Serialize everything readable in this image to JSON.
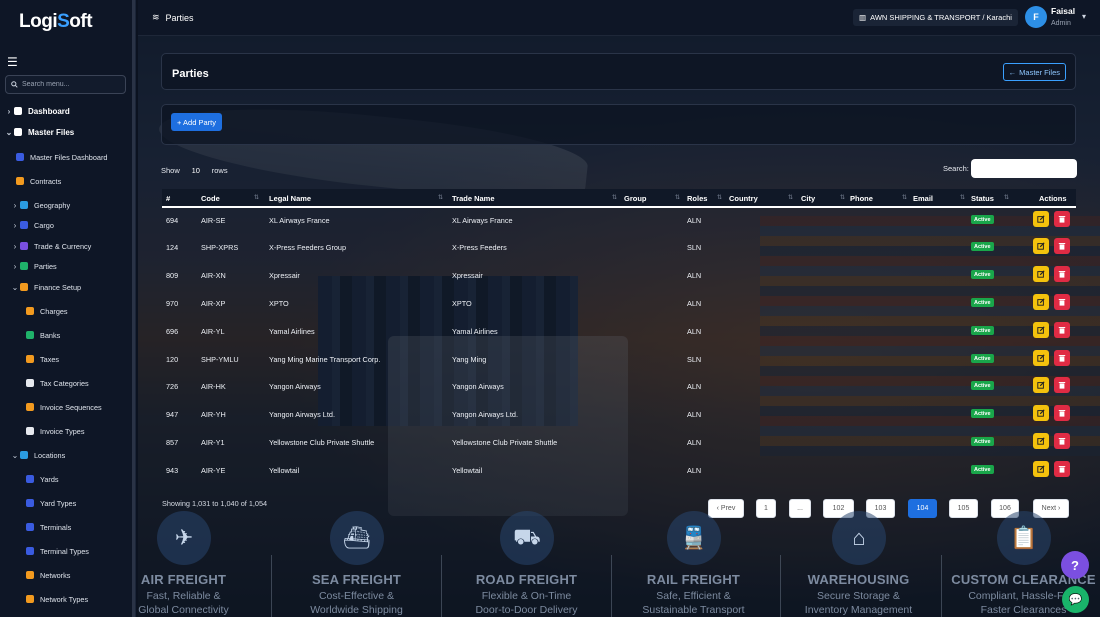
{
  "app": {
    "logo_a": "Logi",
    "logo_o": "S",
    "logo_b": "oft"
  },
  "sidebar": {
    "search_placeholder": "Search menu...",
    "items": [
      {
        "label": "Dashboard",
        "caret": "›",
        "level": 0,
        "color": "#ffffff"
      },
      {
        "label": "Master Files",
        "caret": "⌄",
        "level": 0,
        "color": "#ffffff"
      },
      {
        "label": "Master Files Dashboard",
        "caret": "",
        "level": 1,
        "color": "#3a5be0"
      },
      {
        "label": "Contracts",
        "caret": "",
        "level": 1,
        "color": "#f29a1f"
      },
      {
        "label": "Geography",
        "caret": "›",
        "level": 1,
        "color": "#2a9be0"
      },
      {
        "label": "Cargo",
        "caret": "›",
        "level": 1,
        "color": "#3a5be0"
      },
      {
        "label": "Trade & Currency",
        "caret": "›",
        "level": 1,
        "color": "#7a4fe0"
      },
      {
        "label": "Parties",
        "caret": "›",
        "level": 1,
        "color": "#1fb26a"
      },
      {
        "label": "Finance Setup",
        "caret": "⌄",
        "level": 1,
        "color": "#f29a1f"
      },
      {
        "label": "Charges",
        "caret": "",
        "level": 2,
        "color": "#f29a1f"
      },
      {
        "label": "Banks",
        "caret": "",
        "level": 2,
        "color": "#1fb26a"
      },
      {
        "label": "Taxes",
        "caret": "",
        "level": 2,
        "color": "#f29a1f"
      },
      {
        "label": "Tax Categories",
        "caret": "",
        "level": 2,
        "color": "#e6e9ef"
      },
      {
        "label": "Invoice Sequences",
        "caret": "",
        "level": 2,
        "color": "#f29a1f"
      },
      {
        "label": "Invoice Types",
        "caret": "",
        "level": 2,
        "color": "#e6e9ef"
      },
      {
        "label": "Locations",
        "caret": "⌄",
        "level": 1,
        "color": "#2a9be0"
      },
      {
        "label": "Yards",
        "caret": "",
        "level": 2,
        "color": "#3a5be0"
      },
      {
        "label": "Yard Types",
        "caret": "",
        "level": 2,
        "color": "#3a5be0"
      },
      {
        "label": "Terminals",
        "caret": "",
        "level": 2,
        "color": "#3a5be0"
      },
      {
        "label": "Terminal Types",
        "caret": "",
        "level": 2,
        "color": "#3a5be0"
      },
      {
        "label": "Networks",
        "caret": "",
        "level": 2,
        "color": "#f29a1f"
      },
      {
        "label": "Network Types",
        "caret": "",
        "level": 2,
        "color": "#f29a1f"
      }
    ]
  },
  "topbar": {
    "title": "Parties",
    "company": "AWN SHIPPING & TRANSPORT / Karachi",
    "user_initial": "F",
    "user_name": "Faisal",
    "user_role": "Admin"
  },
  "page": {
    "title": "Parties",
    "master_files_label": "Master Files",
    "add_party_label": "+ Add Party",
    "show_label": "Show",
    "rows_value": "10",
    "rows_label": "rows",
    "search_label": "Search:"
  },
  "table": {
    "headers": [
      "#",
      "Code",
      "Legal Name",
      "Trade Name",
      "Group",
      "Roles",
      "Country",
      "City",
      "Phone",
      "Email",
      "Status",
      "Actions"
    ],
    "rows": [
      {
        "id": "694",
        "code": "AIR-SE",
        "legal": "XL Airways France",
        "trade": "XL Airways France",
        "roles": "ALN",
        "status": "Active"
      },
      {
        "id": "124",
        "code": "SHP-XPRS",
        "legal": "X-Press Feeders Group",
        "trade": "X-Press Feeders",
        "roles": "SLN",
        "status": "Active"
      },
      {
        "id": "809",
        "code": "AIR-XN",
        "legal": "Xpressair",
        "trade": "Xpressair",
        "roles": "ALN",
        "status": "Active"
      },
      {
        "id": "970",
        "code": "AIR-XP",
        "legal": "XPTO",
        "trade": "XPTO",
        "roles": "ALN",
        "status": "Active"
      },
      {
        "id": "696",
        "code": "AIR-YL",
        "legal": "Yamal Airlines",
        "trade": "Yamal Airlines",
        "roles": "ALN",
        "status": "Active"
      },
      {
        "id": "120",
        "code": "SHP-YMLU",
        "legal": "Yang Ming Marine Transport Corp.",
        "trade": "Yang Ming",
        "roles": "SLN",
        "status": "Active"
      },
      {
        "id": "726",
        "code": "AIR-HK",
        "legal": "Yangon Airways",
        "trade": "Yangon Airways",
        "roles": "ALN",
        "status": "Active"
      },
      {
        "id": "947",
        "code": "AIR-YH",
        "legal": "Yangon Airways Ltd.",
        "trade": "Yangon Airways Ltd.",
        "roles": "ALN",
        "status": "Active"
      },
      {
        "id": "857",
        "code": "AIR-Y1",
        "legal": "Yellowstone Club Private Shuttle",
        "trade": "Yellowstone Club Private Shuttle",
        "roles": "ALN",
        "status": "Active"
      },
      {
        "id": "943",
        "code": "AIR-YE",
        "legal": "Yellowtail",
        "trade": "Yellowtail",
        "roles": "ALN",
        "status": "Active"
      }
    ]
  },
  "pagination": {
    "info": "Showing 1,031 to 1,040 of 1,054",
    "buttons": [
      "‹ Prev",
      "1",
      "...",
      "102",
      "103",
      "104",
      "105",
      "106",
      "Next ›"
    ],
    "active": "104"
  },
  "services": [
    {
      "title": "AIR FREIGHT",
      "line1": "Fast, Reliable &",
      "line2": "Global Connectivity",
      "icon": "airplane-icon"
    },
    {
      "title": "SEA FREIGHT",
      "line1": "Cost-Effective &",
      "line2": "Worldwide Shipping",
      "icon": "ship-icon"
    },
    {
      "title": "ROAD FREIGHT",
      "line1": "Flexible & On-Time",
      "line2": "Door-to-Door Delivery",
      "icon": "truck-icon"
    },
    {
      "title": "RAIL FREIGHT",
      "line1": "Safe, Efficient &",
      "line2": "Sustainable Transport",
      "icon": "train-icon"
    },
    {
      "title": "WAREHOUSING",
      "line1": "Secure Storage &",
      "line2": "Inventory Management",
      "icon": "warehouse-icon"
    },
    {
      "title": "CUSTOM CLEARANCE",
      "line1": "Compliant, Hassle-Free",
      "line2": "Faster Clearances",
      "icon": "clipboard-icon"
    }
  ],
  "widgets": {
    "help": "?",
    "chat": "💬"
  }
}
